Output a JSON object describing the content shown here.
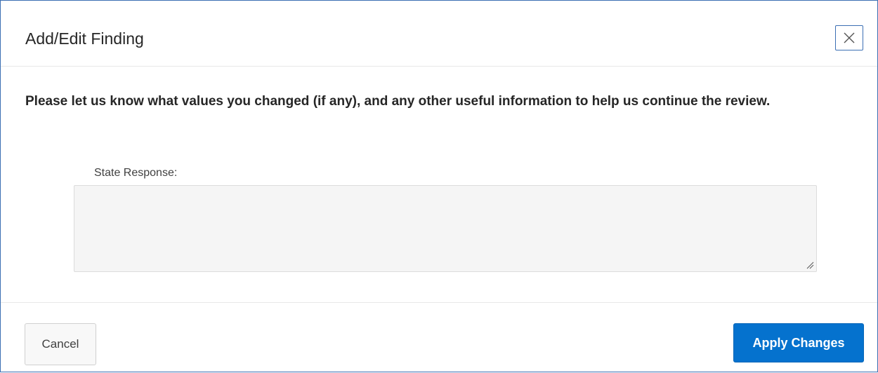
{
  "dialog": {
    "title": "Add/Edit Finding",
    "close_icon": "close-icon"
  },
  "body": {
    "instructions": "Please let us know what values you changed (if any), and any other useful information to help us continue the review.",
    "state_response": {
      "label": "State Response:",
      "value": ""
    }
  },
  "footer": {
    "cancel_label": "Cancel",
    "apply_label": "Apply Changes"
  },
  "colors": {
    "accent": "#0572ce",
    "dialog_border": "#3b6fb3",
    "textarea_bg": "#f5f5f5"
  }
}
